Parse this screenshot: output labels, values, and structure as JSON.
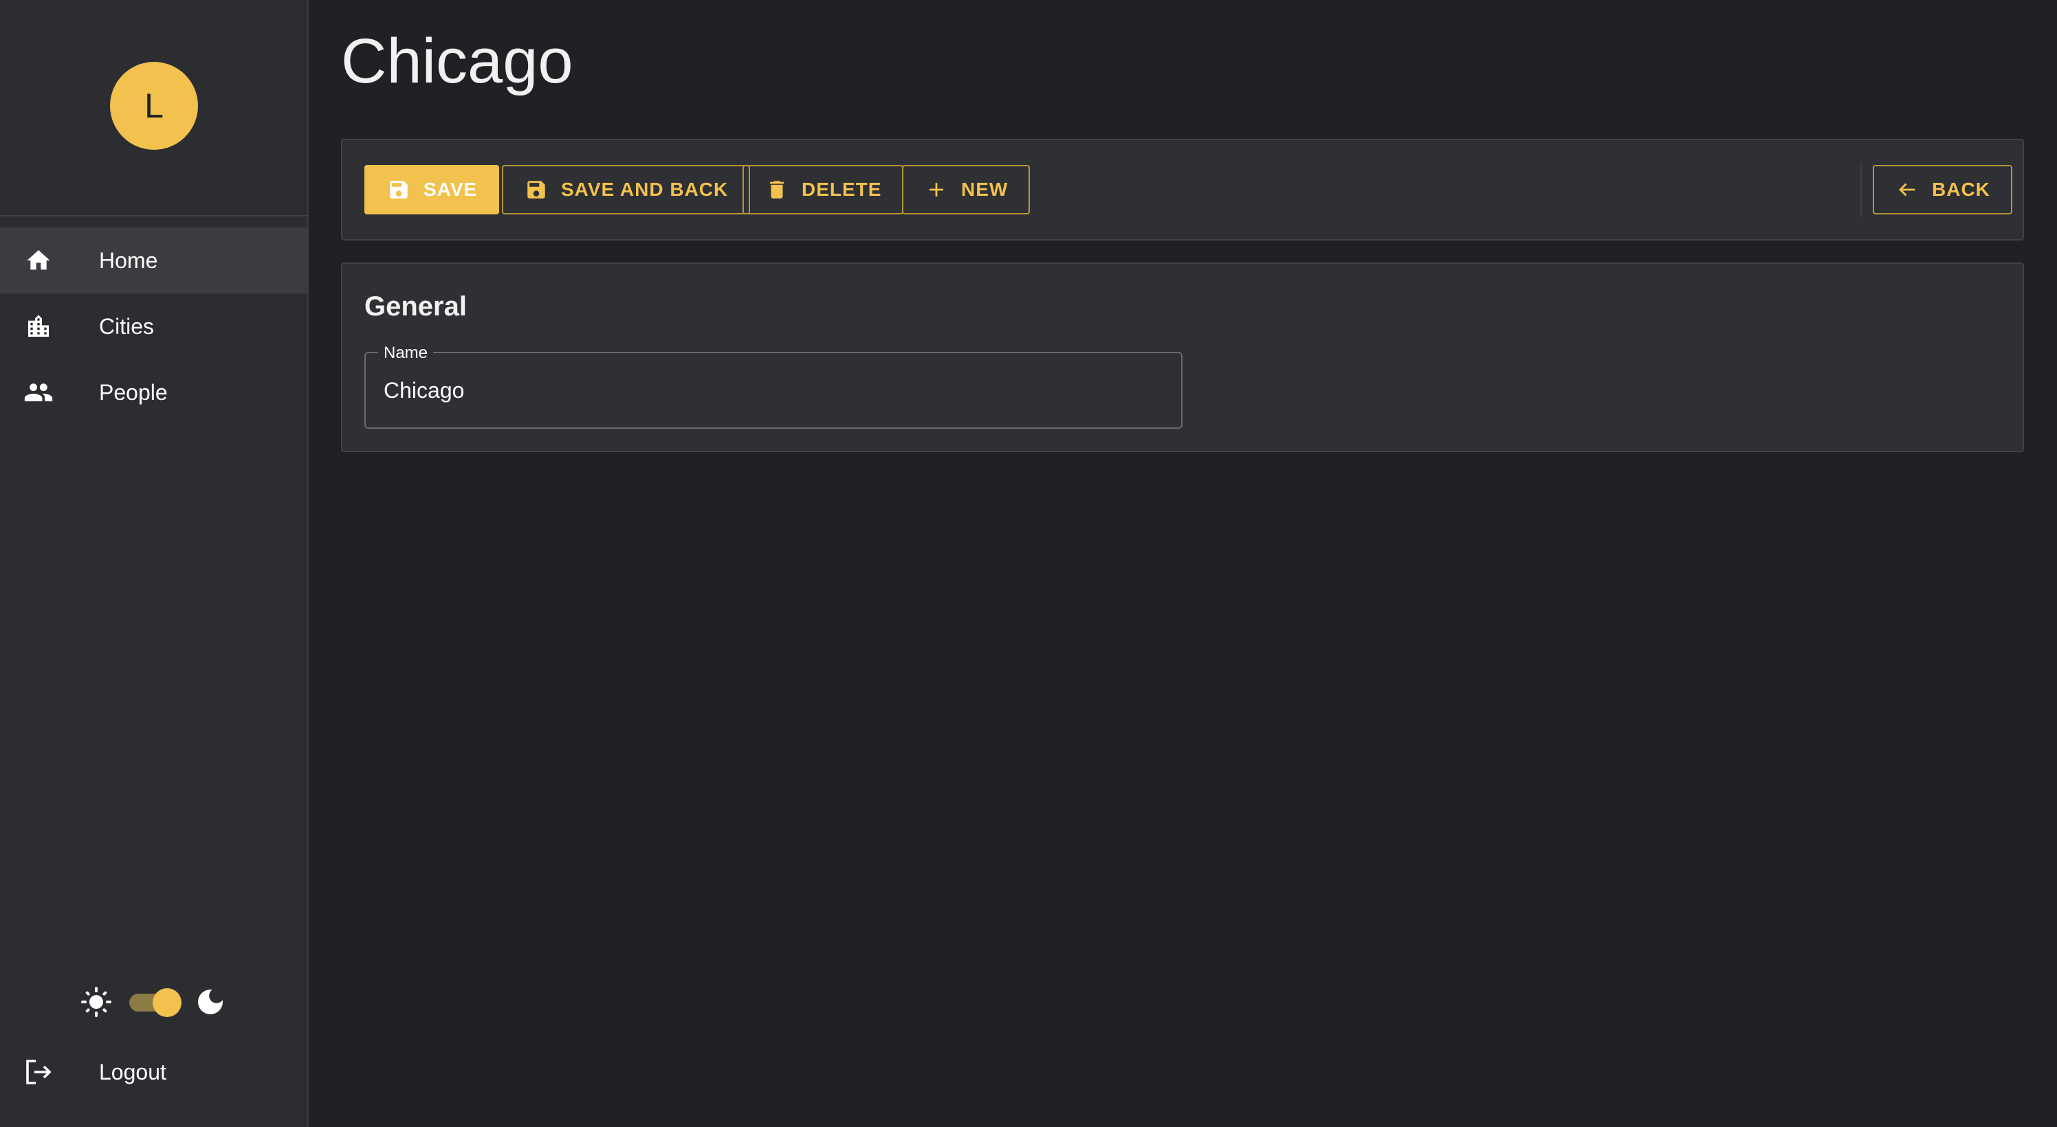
{
  "user": {
    "avatar_initial": "L"
  },
  "sidebar": {
    "items": [
      {
        "label": "Home",
        "icon": "home-icon"
      },
      {
        "label": "Cities",
        "icon": "city-icon"
      },
      {
        "label": "People",
        "icon": "people-icon"
      }
    ],
    "active_item": "Home",
    "theme": {
      "mode": "dark",
      "toggle_on": true
    },
    "logout_label": "Logout"
  },
  "page": {
    "title": "Chicago"
  },
  "toolbar": {
    "save_label": "SAVE",
    "save_and_back_label": "SAVE AND BACK",
    "delete_label": "DELETE",
    "new_label": "NEW",
    "back_label": "BACK"
  },
  "form": {
    "section_title": "General",
    "name_label": "Name",
    "name_value": "Chicago"
  },
  "colors": {
    "accent": "#f2c14e",
    "background": "#202124",
    "surface": "#2f3034",
    "sidebar": "#2c2d31"
  }
}
